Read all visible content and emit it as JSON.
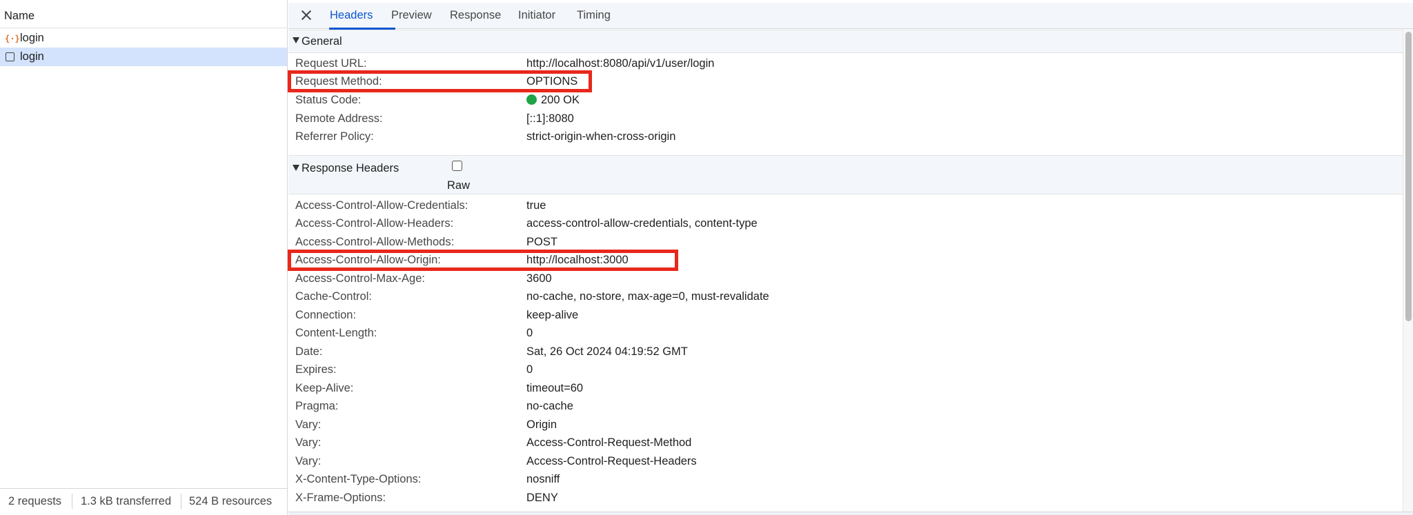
{
  "left": {
    "header": "Name",
    "requests": [
      {
        "label": "login",
        "icon": "xhr-icon",
        "selected": false
      },
      {
        "label": "login",
        "icon": "document-icon",
        "selected": true
      }
    ],
    "footer": {
      "requests": "2 requests",
      "transferred": "1.3 kB transferred",
      "resources": "524 B resources"
    }
  },
  "tabs": {
    "items": [
      "Headers",
      "Preview",
      "Response",
      "Initiator",
      "Timing"
    ],
    "active": "Headers"
  },
  "general": {
    "title": "General",
    "rows": [
      {
        "key": "Request URL:",
        "value": "http://localhost:8080/api/v1/user/login"
      },
      {
        "key": "Request Method:",
        "value": "OPTIONS"
      },
      {
        "key": "Status Code:",
        "value": "200 OK"
      },
      {
        "key": "Remote Address:",
        "value": "[::1]:8080"
      },
      {
        "key": "Referrer Policy:",
        "value": "strict-origin-when-cross-origin"
      }
    ]
  },
  "response_headers": {
    "title": "Response Headers",
    "raw_label": "Raw",
    "rows": [
      {
        "key": "Access-Control-Allow-Credentials:",
        "value": "true"
      },
      {
        "key": "Access-Control-Allow-Headers:",
        "value": "access-control-allow-credentials, content-type"
      },
      {
        "key": "Access-Control-Allow-Methods:",
        "value": "POST"
      },
      {
        "key": "Access-Control-Allow-Origin:",
        "value": "http://localhost:3000"
      },
      {
        "key": "Access-Control-Max-Age:",
        "value": "3600"
      },
      {
        "key": "Cache-Control:",
        "value": "no-cache, no-store, max-age=0, must-revalidate"
      },
      {
        "key": "Connection:",
        "value": "keep-alive"
      },
      {
        "key": "Content-Length:",
        "value": "0"
      },
      {
        "key": "Date:",
        "value": "Sat, 26 Oct 2024 04:19:52 GMT"
      },
      {
        "key": "Expires:",
        "value": "0"
      },
      {
        "key": "Keep-Alive:",
        "value": "timeout=60"
      },
      {
        "key": "Pragma:",
        "value": "no-cache"
      },
      {
        "key": "Vary:",
        "value": "Origin"
      },
      {
        "key": "Vary:",
        "value": "Access-Control-Request-Method"
      },
      {
        "key": "Vary:",
        "value": "Access-Control-Request-Headers"
      },
      {
        "key": "X-Content-Type-Options:",
        "value": "nosniff"
      },
      {
        "key": "X-Frame-Options:",
        "value": "DENY"
      }
    ]
  },
  "colors": {
    "accent": "#0b57d0",
    "selected_row": "#d3e3fd",
    "highlight_box": "#e8281b",
    "status_ok": "#1ea446"
  }
}
